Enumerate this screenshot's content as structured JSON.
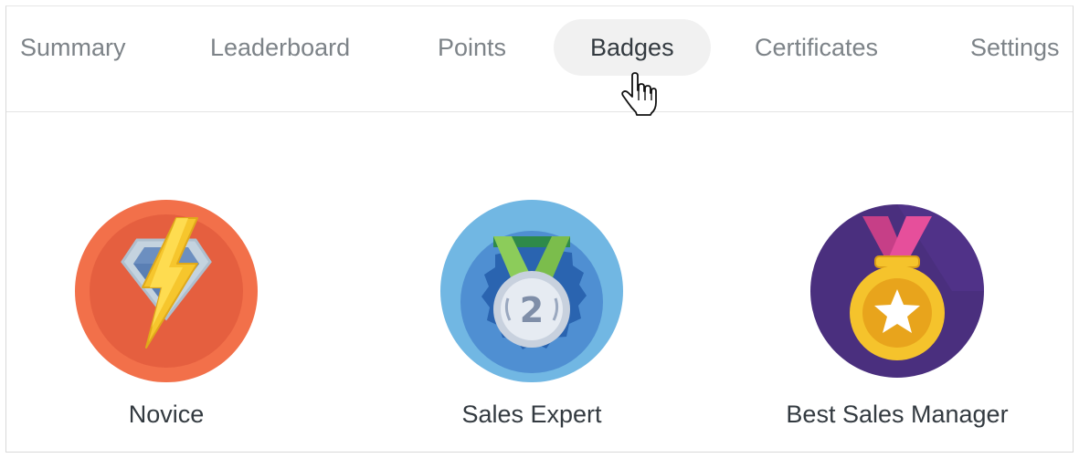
{
  "tabs": [
    {
      "label": "Summary"
    },
    {
      "label": "Leaderboard"
    },
    {
      "label": "Points"
    },
    {
      "label": "Badges"
    },
    {
      "label": "Certificates"
    },
    {
      "label": "Settings"
    }
  ],
  "active_tab": "Badges",
  "badges": [
    {
      "name": "Novice",
      "icon": "lightning-diamond-icon"
    },
    {
      "name": "Sales Expert",
      "icon": "medal-2-icon"
    },
    {
      "name": "Best Sales Manager",
      "icon": "gold-star-medal-icon"
    }
  ],
  "colors": {
    "novice_outer": "#f2704a",
    "novice_inner": "#e55f3f",
    "expert_outer": "#71b7e3",
    "expert_inner": "#2a64b0",
    "manager_outer": "#4a2f7e",
    "manager_medal": "#f5c32c",
    "ribbon_pink": "#e64f9b",
    "tab_active_bg": "#f1f1f1"
  }
}
